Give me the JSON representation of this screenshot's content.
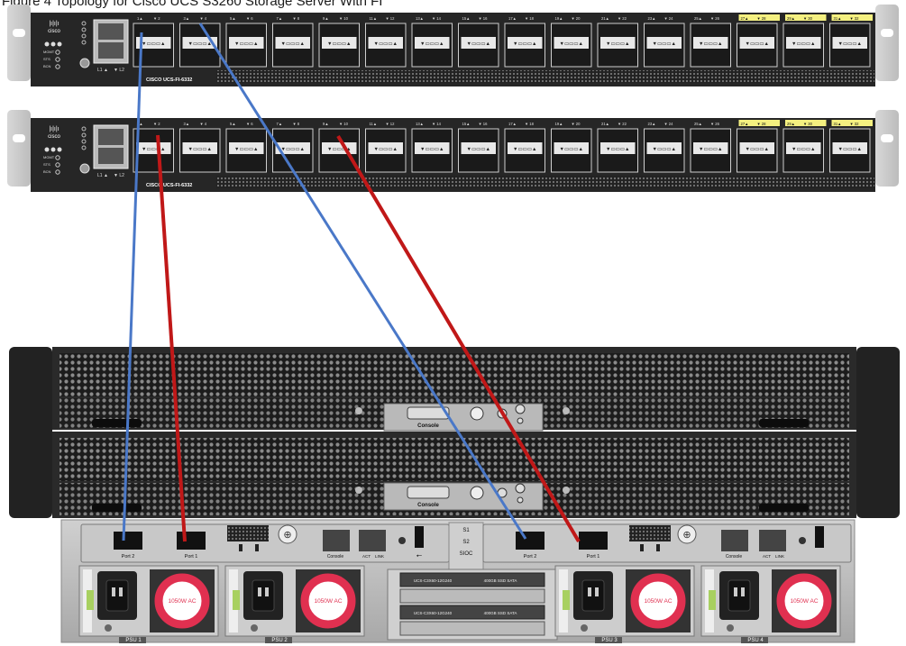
{
  "title": "Figure 4 Topology for Cisco UCS S3260 Storage Server With FI",
  "fi": {
    "model": "CISCO UCS-FI-6332",
    "brand": "cisco",
    "mgmt_labels": [
      "MGMT",
      "STS",
      "BCN"
    ],
    "link_labels": [
      "L1",
      "L2"
    ],
    "port_labels": [
      "1",
      "2",
      "3",
      "4",
      "5",
      "6",
      "7",
      "8",
      "9",
      "10",
      "11",
      "12",
      "13",
      "14",
      "15",
      "16",
      "17",
      "18",
      "19",
      "20",
      "21",
      "22",
      "23",
      "24",
      "25",
      "26",
      "27",
      "28",
      "29",
      "30",
      "31",
      "32"
    ]
  },
  "server": {
    "console_label": "Console",
    "node_left": {
      "port2": "Port 2",
      "port1": "Port 1",
      "console": "Console",
      "act": "ACT",
      "link": "LINK"
    },
    "node_right": {
      "port2": "Port 2",
      "port1": "Port 1",
      "console": "Console",
      "act": "ACT",
      "link": "LINK"
    },
    "sioc_labels": [
      "S1",
      "S2",
      "SIOC"
    ],
    "drive_labels": [
      "UCS-C3X60-12G240",
      "400GB SSD SATA"
    ],
    "psu_rating": "1050W AC",
    "psu_labels": [
      "PSU 1",
      "PSU 2",
      "PSU 3",
      "PSU 4"
    ]
  },
  "connections": [
    {
      "from": "FI-A port 1",
      "to": "Server node 1 Port 2",
      "color": "#4a78c8"
    },
    {
      "from": "FI-A port 3",
      "to": "Server node 2 Port 2",
      "color": "#4a78c8"
    },
    {
      "from": "FI-B port 1",
      "to": "Server node 1 Port 1",
      "color": "#c01818"
    },
    {
      "from": "FI-B port 9",
      "to": "Server node 2 Port 1",
      "color": "#c01818"
    }
  ],
  "colors": {
    "chassis": "#2a2a2a",
    "port_highlight": "#f4f080",
    "blue_cable": "#4a78c8",
    "red_cable": "#c01818",
    "psu_ring": "#e03050"
  }
}
